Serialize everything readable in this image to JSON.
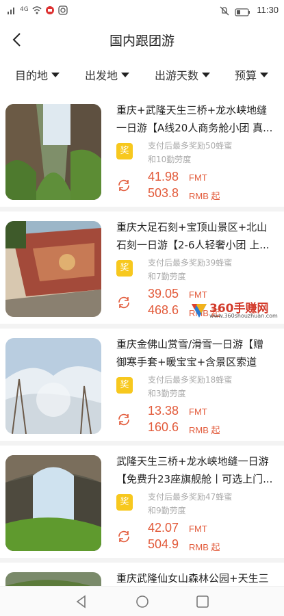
{
  "status_bar": {
    "signal": "4G",
    "time": "11:30"
  },
  "nav": {
    "title": "国内跟团游"
  },
  "filters": [
    {
      "label": "目的地"
    },
    {
      "label": "出发地"
    },
    {
      "label": "出游天数"
    },
    {
      "label": "预算"
    }
  ],
  "cards": [
    {
      "title": "重庆+武隆天生三桥+龙水峡地缝一日游【A线20人商务舱小团 真...",
      "badge": "奖",
      "reward_line1": "支付后最多奖励50蜂蜜",
      "reward_line2": "和10勤劳度",
      "price": "41.98",
      "price_unit": "FMT",
      "price_rmb": "503.8",
      "price_rmb_unit": "RMB 起"
    },
    {
      "title": "重庆大足石刻+宝顶山景区+北山石刻一日游【2-6人轻奢小团 上...",
      "badge": "奖",
      "reward_line1": "支付后最多奖励39蜂蜜",
      "reward_line2": "和7勤劳度",
      "price": "39.05",
      "price_unit": "FMT",
      "price_rmb": "468.6",
      "price_rmb_unit": "RMB 起"
    },
    {
      "title": "重庆金佛山赏雪/滑雪一日游【赠御寒手套+暖宝宝+含景区索道+...",
      "badge": "奖",
      "reward_line1": "支付后最多奖励18蜂蜜",
      "reward_line2": "和3勤劳度",
      "price": "13.38",
      "price_unit": "FMT",
      "price_rmb": "160.6",
      "price_rmb_unit": "RMB 起"
    },
    {
      "title": "武隆天生三桥+龙水峡地缝一日游【免费升23座旗舰舱丨可选上门...",
      "badge": "奖",
      "reward_line1": "支付后最多奖励47蜂蜜",
      "reward_line2": "和9勤劳度",
      "price": "42.07",
      "price_unit": "FMT",
      "price_rmb": "504.9",
      "price_rmb_unit": "RMB 起"
    },
    {
      "title": "重庆武隆仙女山森林公园+天生三"
    }
  ],
  "watermark": {
    "text": "360手赚网",
    "url": "www.360shouzhuan.com"
  },
  "colors": {
    "accent": "#e25a3a",
    "badge": "#f7c81e"
  }
}
